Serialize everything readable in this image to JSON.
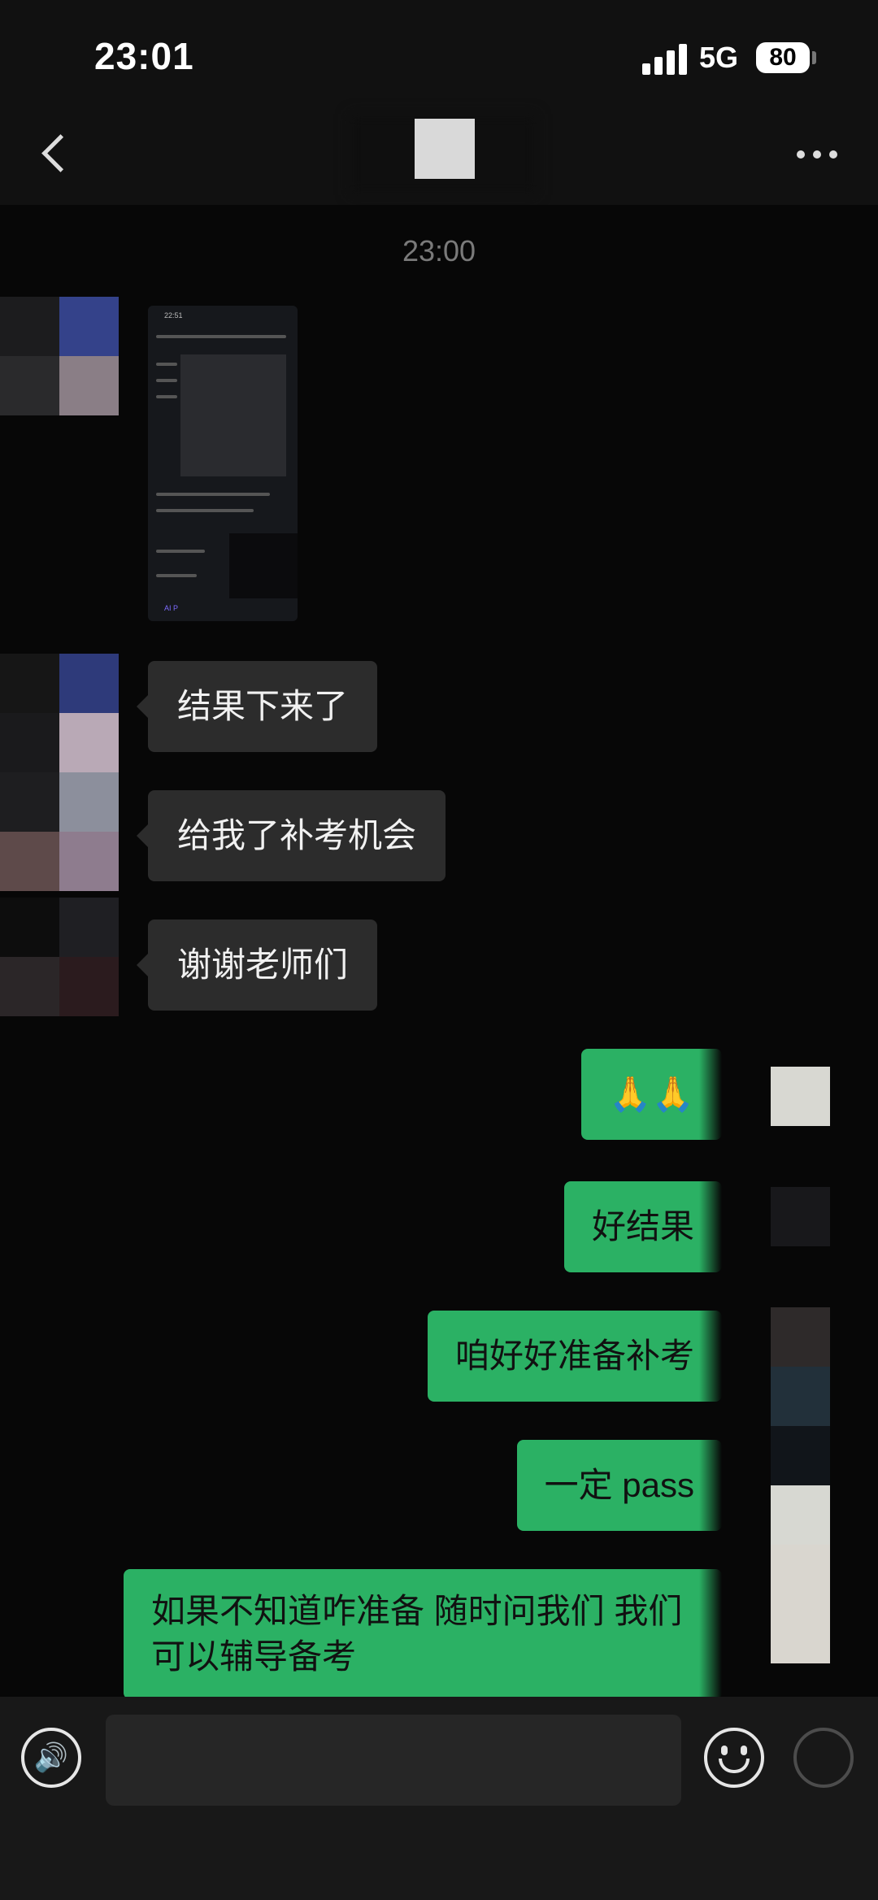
{
  "status_bar": {
    "time": "23:01",
    "network": "5G",
    "battery": "80"
  },
  "nav": {
    "back_label": "",
    "more_label": ""
  },
  "chat": {
    "timestamp": "23:00",
    "screenshot_preview": {
      "time": "22:51",
      "footer": "AI  P"
    },
    "received": [
      "结果下来了",
      "给我了补考机会",
      "谢谢老师们"
    ],
    "sent": [
      "🙏🙏",
      "好结果",
      "咱好好准备补考",
      "一定 pass",
      "如果不知道咋准备 随时问我们 我们可以辅导备考"
    ]
  },
  "input": {
    "placeholder": ""
  }
}
